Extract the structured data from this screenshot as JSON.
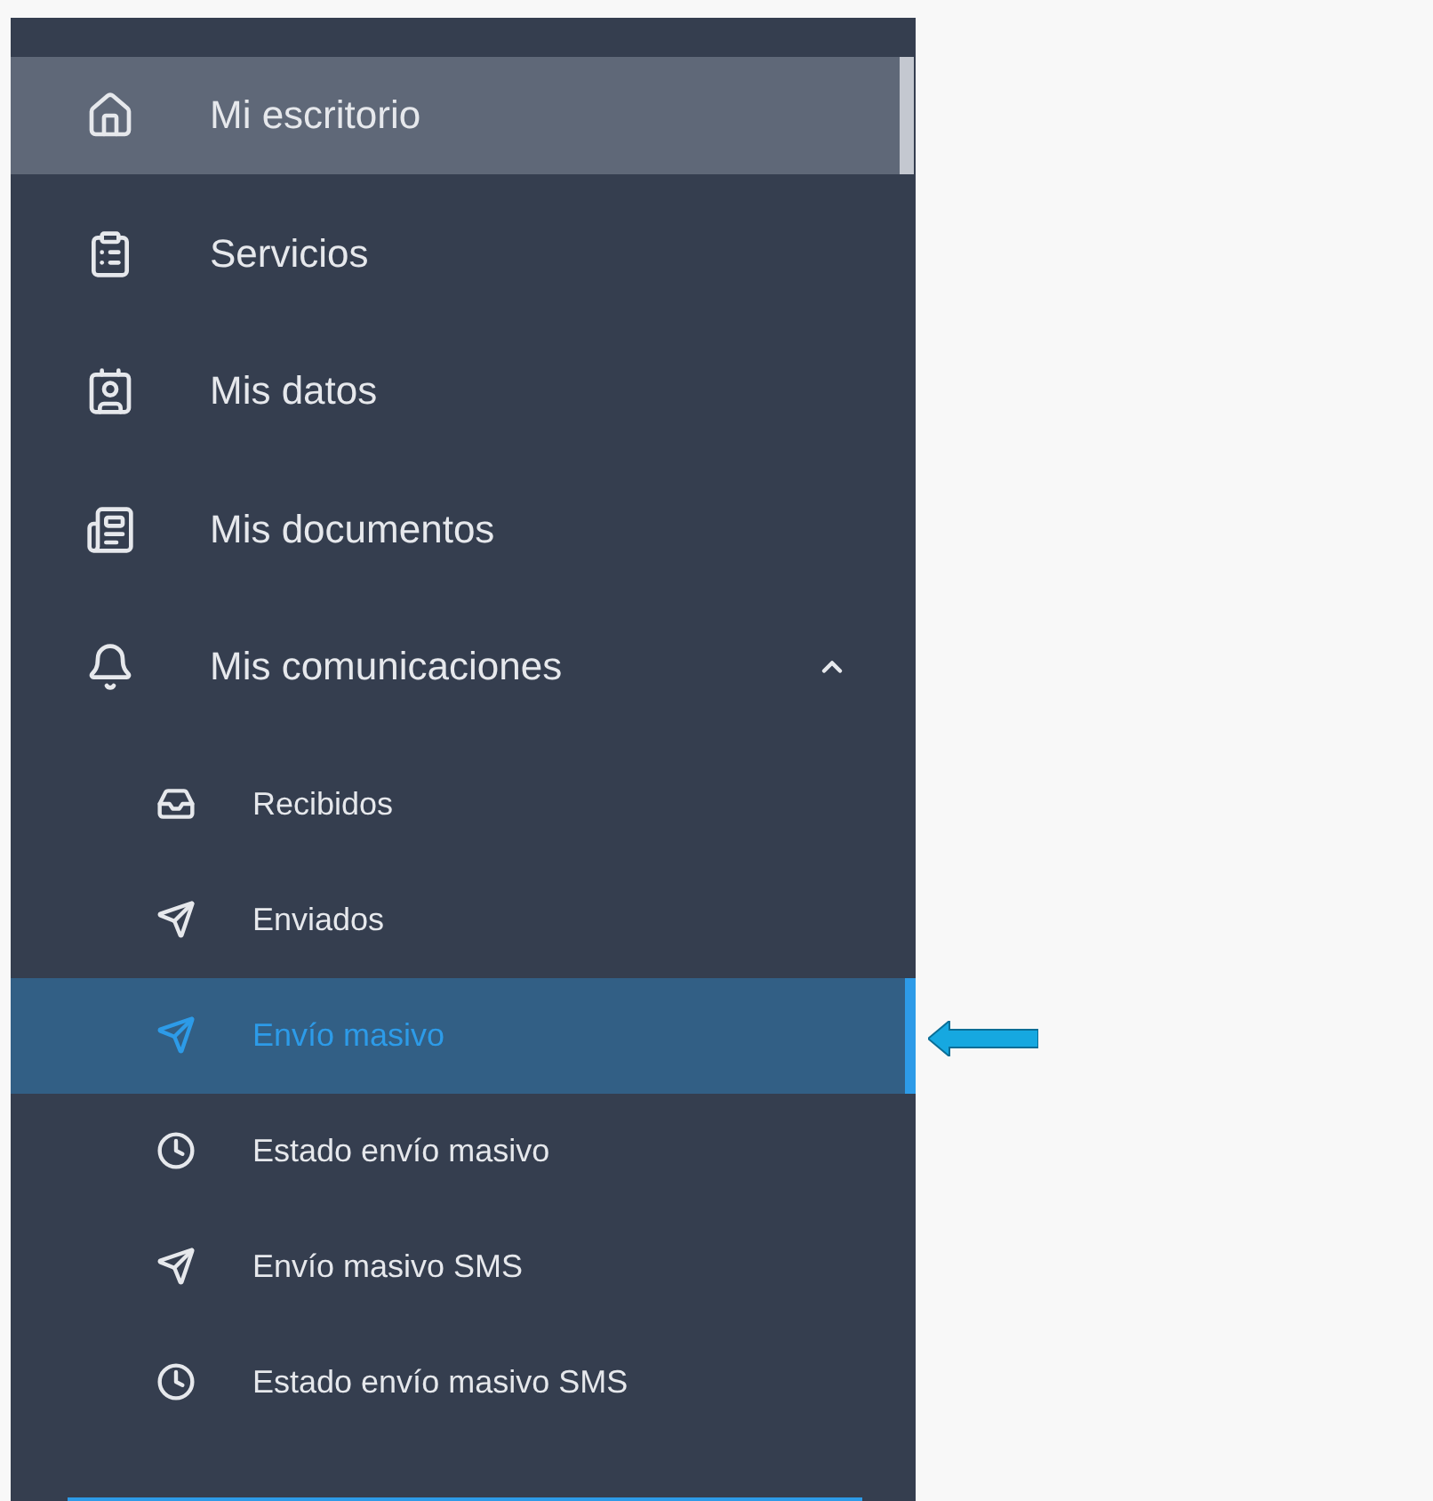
{
  "sidebar": {
    "items": [
      {
        "label": "Mi escritorio",
        "highlighted": true
      },
      {
        "label": "Servicios",
        "highlighted": false
      },
      {
        "label": "Mis datos",
        "highlighted": false
      },
      {
        "label": "Mis documentos",
        "highlighted": false
      },
      {
        "label": "Mis comunicaciones",
        "highlighted": false,
        "expanded": true,
        "children": [
          {
            "label": "Recibidos",
            "selected": false
          },
          {
            "label": "Enviados",
            "selected": false
          },
          {
            "label": "Envío masivo",
            "selected": true
          },
          {
            "label": "Estado envío masivo",
            "selected": false
          },
          {
            "label": "Envío masivo SMS",
            "selected": false
          },
          {
            "label": "Estado envío masivo SMS",
            "selected": false
          }
        ]
      }
    ]
  }
}
